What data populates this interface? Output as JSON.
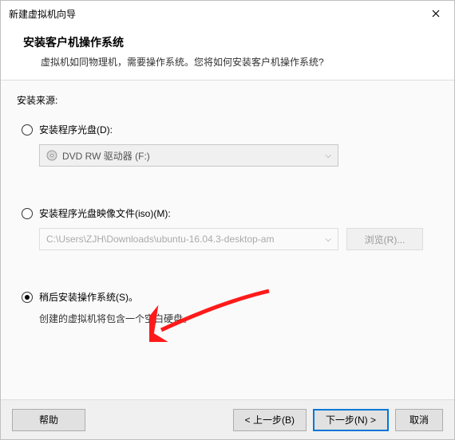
{
  "window": {
    "title": "新建虚拟机向导"
  },
  "header": {
    "title": "安装客户机操作系统",
    "subtitle": "虚拟机如同物理机，需要操作系统。您将如何安装客户机操作系统?"
  },
  "body": {
    "source_label": "安装来源:",
    "opt_disc": {
      "label": "安装程序光盘(D):",
      "dropdown_text": "DVD RW 驱动器 (F:)"
    },
    "opt_iso": {
      "label": "安装程序光盘映像文件(iso)(M):",
      "path": "C:\\Users\\ZJH\\Downloads\\ubuntu-16.04.3-desktop-am",
      "browse": "浏览(R)..."
    },
    "opt_later": {
      "label": "稍后安装操作系统(S)。",
      "hint": "创建的虚拟机将包含一个空白硬盘。"
    }
  },
  "footer": {
    "help": "帮助",
    "back": "< 上一步(B)",
    "next": "下一步(N) >",
    "cancel": "取消"
  }
}
